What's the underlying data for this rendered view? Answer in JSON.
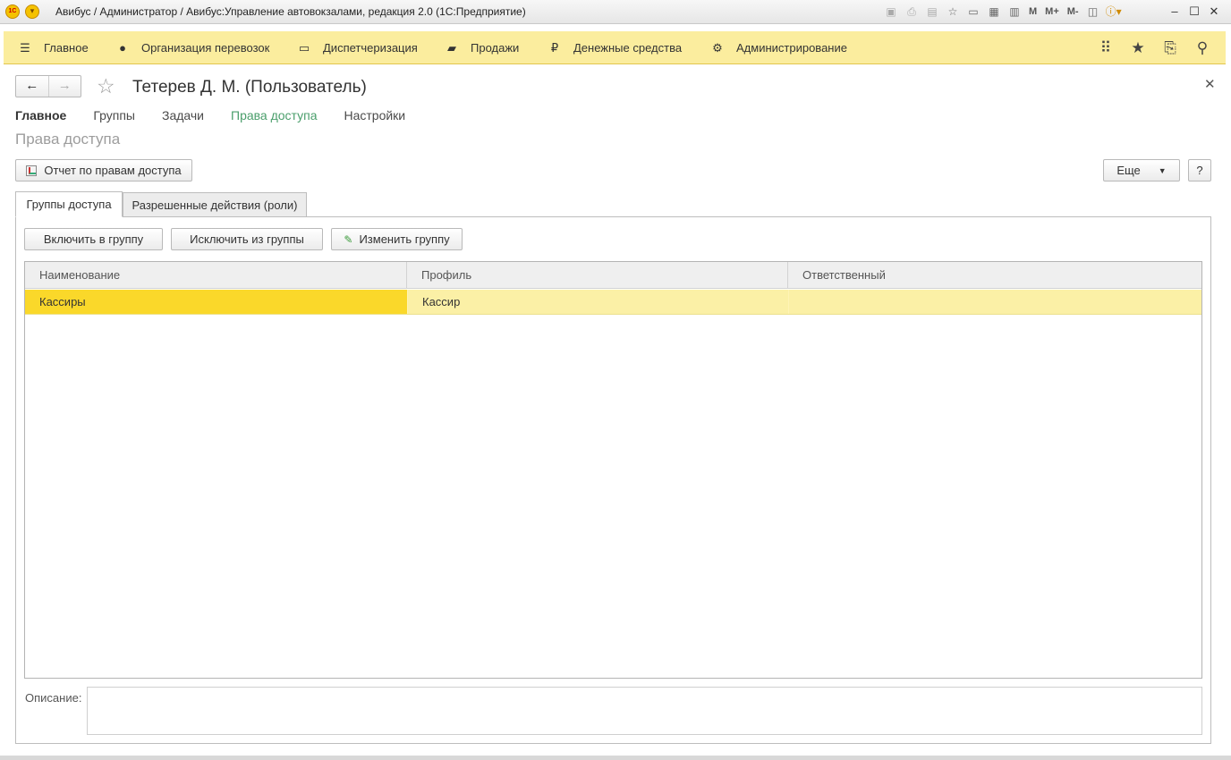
{
  "window": {
    "title": "Авибус / Администратор / Авибус:Управление автовокзалами, редакция 2.0  (1С:Предприятие)",
    "logo_text": "1С",
    "tools": [
      "save-icon",
      "print-icon",
      "preview-icon",
      "favorites-icon",
      "document-icon",
      "calculator-icon",
      "calendar-icon"
    ],
    "mem_buttons": [
      "M",
      "M+",
      "M-"
    ]
  },
  "nav": {
    "items": [
      {
        "label": "Главное",
        "icon": "menu-icon"
      },
      {
        "label": "Организация перевозок",
        "icon": "location-pin-icon"
      },
      {
        "label": "Диспетчеризация",
        "icon": "bus-icon"
      },
      {
        "label": "Продажи",
        "icon": "shopping-bag-icon"
      },
      {
        "label": "Денежные средства",
        "icon": "ruble-icon"
      },
      {
        "label": "Администрирование",
        "icon": "gear-icon"
      }
    ]
  },
  "form": {
    "title": "Тетерев Д. М. (Пользователь)",
    "tabs": [
      {
        "label": "Главное"
      },
      {
        "label": "Группы"
      },
      {
        "label": "Задачи"
      },
      {
        "label": "Права доступа"
      },
      {
        "label": "Настройки"
      }
    ],
    "section_title": "Права доступа",
    "report_button": "Отчет по правам доступа",
    "more_button": "Еще",
    "help_button": "?"
  },
  "inner_tabs": [
    "Группы доступа",
    "Разрешенные действия (роли)"
  ],
  "actions": {
    "include": "Включить в группу",
    "exclude": "Исключить из группы",
    "edit": "Изменить группу"
  },
  "table": {
    "columns": [
      "Наименование",
      "Профиль",
      "Ответственный"
    ],
    "rows": [
      {
        "name": "Кассиры",
        "profile": "Кассир",
        "responsible": ""
      }
    ]
  },
  "description": {
    "label": "Описание:",
    "value": ""
  },
  "colors": {
    "nav_background": "#fbed9e",
    "selected_cell": "#fad82a",
    "selected_row": "#fbf0a6",
    "active_tab": "#4a9e6b"
  }
}
